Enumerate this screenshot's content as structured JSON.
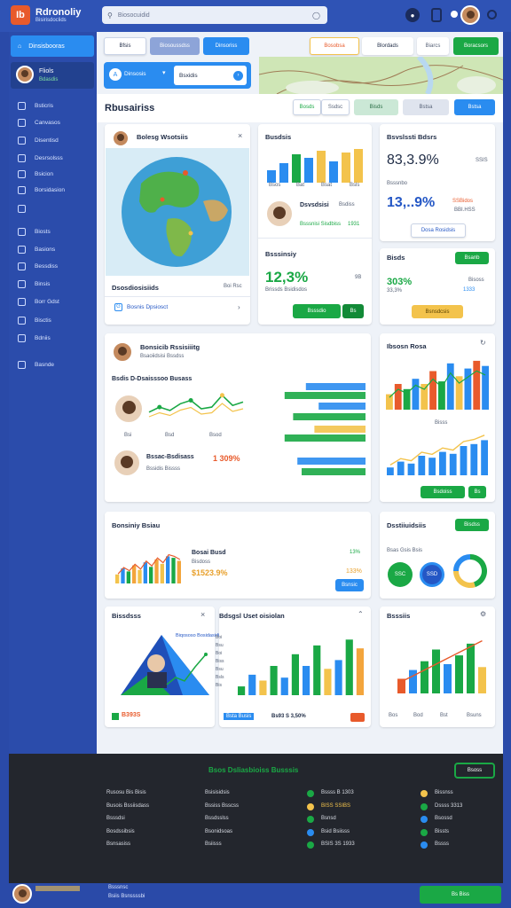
{
  "app": {
    "logo_text": "Ib",
    "title": "Rdronoliy",
    "subtitle": "Bisirisdoclids"
  },
  "search": {
    "placeholder": "Biosocuidid"
  },
  "sidebar": {
    "active_label": "Dinsisbooras",
    "user_name": "Fliols",
    "user_status": "Bdasdis",
    "items": [
      "Bsticris",
      "Canvasos",
      "Disentisd",
      "Desrsolsss",
      "Bsicion",
      "Borsidasion",
      "",
      "Biosts",
      "Basions",
      "Bessdiss",
      "Binsis",
      "Borr Gdst",
      "Bisctis",
      "Bdniis",
      "Basnde"
    ]
  },
  "toolbar": {
    "tabs": [
      "Bfsis",
      "Biosoussdss",
      "Dinsoriss"
    ],
    "right_buttons": [
      "Bosobsa",
      "Blordads",
      "Biarcs",
      "Boracsors"
    ],
    "filter_select": "Dinsosis",
    "filter_input": "Bsxidis"
  },
  "overview": {
    "title": "Rbusairiss",
    "actions": [
      "Bosds",
      "Ssdsc",
      "Bisds",
      "Bstsa"
    ]
  },
  "map_card": {
    "title": "Bolesg Wsotsiis",
    "footer_title": "Dsosdiosisiids",
    "footer_value": "Boi Rsc",
    "link": "Bosnis Dpsiosct",
    "count": "G"
  },
  "bars_card": {
    "title": "Busdsis",
    "x_labels": [
      "Bsos",
      "Bat",
      "Bsat",
      "Bsls"
    ],
    "person_title": "Dsvsdsisi",
    "person_value": "Bsdiss",
    "person_sub": "Bsssnisi Sisdbiss",
    "person_num": "1931",
    "values": [
      0.35,
      0.55,
      0.8,
      0.7,
      0.9,
      0.6,
      0.85,
      0.95
    ],
    "colors": [
      "#2a8cf0",
      "#2a8cf0",
      "#1aa845",
      "#2a8cf0",
      "#f3c34c",
      "#2a8cf0",
      "#f3c34c",
      "#f3c34c"
    ]
  },
  "stat_card": {
    "title": "Bsvslssti Bdsrs",
    "value": "83,3.9%",
    "tag": "SSIS",
    "label": "Bsssnbo",
    "value2": "13,..9%",
    "aside1": "SSBidos",
    "aside2": "BBI.HSS",
    "button": "Dosa Rosidsis"
  },
  "growth_card": {
    "title": "Bsssinsiy",
    "value": "12,3%",
    "sub": "Brissds Bsidisdos",
    "num": "9B",
    "button": "Bsssdio",
    "button2": "Bs"
  },
  "sales_card": {
    "title": "Bisds",
    "button": "Bsanb",
    "value": "303%",
    "value2": "33,3%",
    "aside": "Bisoss",
    "aside2": "1333",
    "button_yellow": "Bsnsdcsis"
  },
  "team_card": {
    "title": "Bonsicib Rssisiiitg",
    "subtitle": "Bsaoiidsisi Bssdss",
    "section": "Bsdis D-Dsaisssoo Busass",
    "person2_name": "Bssac-Bsdisass",
    "person2_sub": "Bssidis Bissss",
    "person2_value": "1 309%",
    "chart_labels": [
      "Bsi",
      "Bsd",
      "Bsod"
    ],
    "line_values": [
      0.4,
      0.55,
      0.45,
      0.65,
      0.75,
      0.5,
      0.55,
      0.9,
      0.6,
      0.7
    ],
    "hbars": [
      0.7,
      0.95,
      0.55,
      0.85,
      0.6,
      0.95,
      0.8,
      0.75
    ]
  },
  "mixed_card": {
    "title": "Ibsosn Rosa",
    "x_label": "Bisss",
    "button": "Bsdoiss",
    "button2": "Bs",
    "values": [
      0.3,
      0.5,
      0.4,
      0.6,
      0.5,
      0.75,
      0.55,
      0.9,
      0.65,
      0.8,
      0.95,
      0.85
    ],
    "line": [
      0.2,
      0.35,
      0.3,
      0.5,
      0.45,
      0.6,
      0.55,
      0.75,
      0.8,
      0.9
    ]
  },
  "revenue_card": {
    "title": "Bonsiniy Bsiau",
    "label": "Bosai Busd",
    "sub": "Bisdoss",
    "value": "$1523.9%",
    "aside": "13%",
    "aside2": "133%",
    "button": "Bsnsic",
    "values": [
      0.3,
      0.5,
      0.4,
      0.6,
      0.45,
      0.7,
      0.55,
      0.8,
      0.65,
      0.9,
      0.85,
      0.75
    ]
  },
  "donut_card": {
    "title": "Dsstiiuidsiis",
    "button": "Bisdss",
    "label": "Bsas Gsis Bsis",
    "values": [
      "SSC",
      "SSD"
    ],
    "slices": [
      0.45,
      0.3,
      0.25
    ]
  },
  "campaign_card": {
    "title": "Bissdsss",
    "legend": "Biqososo Bosidasidia",
    "footer_value": "B393S",
    "footer_sub": "Bosds",
    "tag": "Bsc"
  },
  "distribution_card": {
    "title": "Bdsgsl Uset oisiolan",
    "legend": [
      "Boi",
      "Bsu",
      "Boi",
      "Biss",
      "Bsu",
      "Bsls",
      "Bis",
      "Bsds"
    ],
    "footer": "Bsta Busis",
    "footer_value": "Bs93 S 3,50%",
    "values": [
      0.15,
      0.35,
      0.25,
      0.5,
      0.3,
      0.7,
      0.5,
      0.85,
      0.45,
      0.6,
      0.95,
      0.8
    ],
    "colors": [
      "#1aa845",
      "#2a8cf0",
      "#f3c34c",
      "#1aa845",
      "#2a8cf0",
      "#1aa845",
      "#2a8cf0",
      "#1aa845",
      "#f3c34c",
      "#2a8cf0",
      "#1aa845",
      "#f3a53c"
    ]
  },
  "summary_card": {
    "title": "Bsssiis",
    "x_labels": [
      "Bos",
      "Bod",
      "Bst",
      "Bsuns"
    ],
    "values": [
      0.25,
      0.4,
      0.55,
      0.75,
      0.5,
      0.65,
      0.85,
      0.45
    ],
    "colors": [
      "#e85a2b",
      "#2a8cf0",
      "#1aa845",
      "#1aa845",
      "#2a8cf0",
      "#1aa845",
      "#1aa845",
      "#f3c34c"
    ]
  },
  "footer": {
    "title": "Bsos Dsliasbioiss Busssis",
    "button": "Bsoss",
    "col1": [
      "Rusosu Bis Bisis",
      "Busois Bssiisdass",
      "Bsssdsi",
      "Bosdssibsis",
      "Bsnsasiss"
    ],
    "col2": [
      "Bsisisidsis",
      "Bssiss Bsscss",
      "Bssdsslss",
      "Bsonidsoas",
      "Bsiisss"
    ],
    "col3": [
      "Bssss B 1303",
      "BISS SSIBS",
      "Bsnsd",
      "Bsid Bsiisss",
      "BSIS 3S 1933"
    ],
    "col4": [
      "Bissnss",
      "Dssss 3313",
      "Bsossd",
      "Bissts",
      "Bssss"
    ]
  },
  "bottom": {
    "name": "Bsssnsc",
    "sub": "Bsiis Bsnssssbi",
    "button": "Bs Biss"
  }
}
